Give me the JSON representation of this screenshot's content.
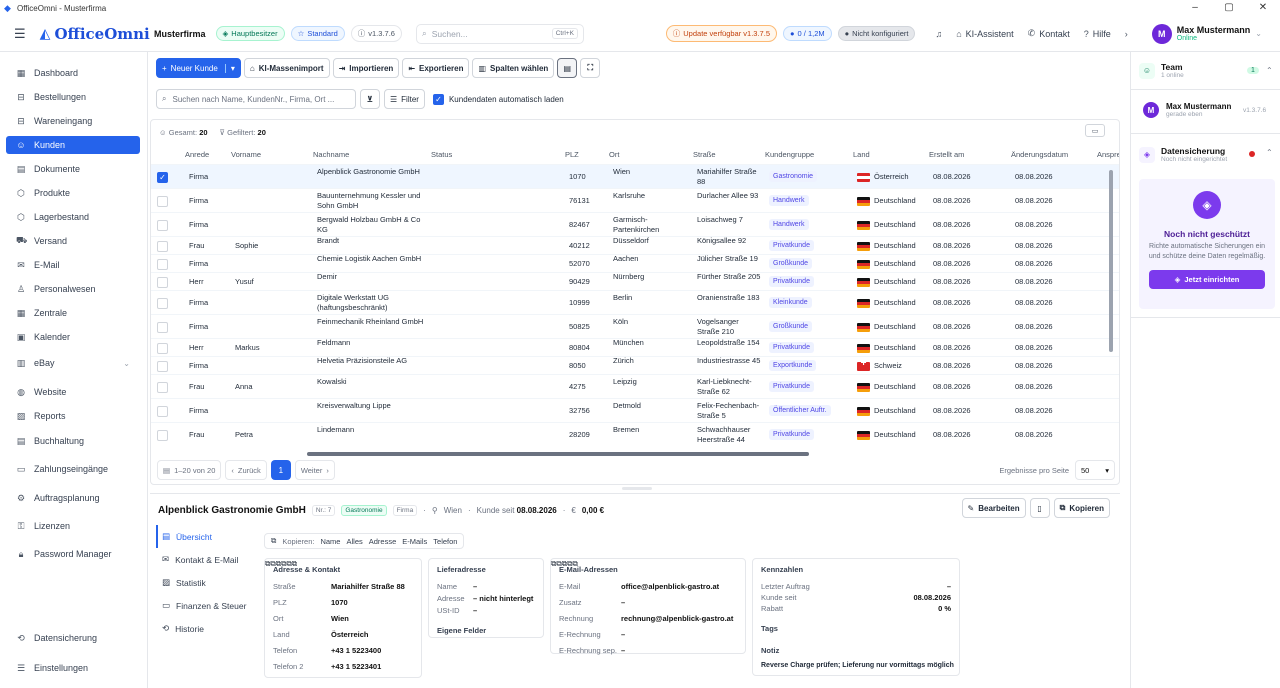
{
  "window": {
    "title": "OfficeOmni - Musterfirma",
    "minimize": "–",
    "maximize": "▢",
    "close": "✕"
  },
  "brand": {
    "name": "OfficeOmni"
  },
  "header": {
    "company": "Musterfirma",
    "badges": [
      "Hauptbesitzer",
      "Standard",
      "v1.3.7.6"
    ],
    "search_placeholder": "Suchen...",
    "search_kbd": "Ctrl+K",
    "update": "Update verfügbar v1.3.7.5",
    "storage": "0 / 1,2M",
    "sync": "Nicht konfiguriert",
    "ai_label": "KI-Assistent",
    "contact_label": "Kontakt",
    "help_label": "Hilfe",
    "user_initial": "M",
    "user_name": "Max Mustermann",
    "user_status": "Online"
  },
  "sidebar": {
    "items": [
      {
        "label": "Dashboard",
        "icon": "dashboard-icon",
        "glyph": "▦"
      },
      {
        "label": "Bestellungen",
        "icon": "cart-icon",
        "glyph": "⊟"
      },
      {
        "label": "Wareneingang",
        "icon": "cart-in-icon",
        "glyph": "⊟"
      },
      {
        "label": "Kunden",
        "icon": "users-icon",
        "glyph": "☺"
      },
      {
        "label": "Dokumente",
        "icon": "document-icon",
        "glyph": "▤"
      },
      {
        "label": "Produkte",
        "icon": "box-icon",
        "glyph": "⬡"
      },
      {
        "label": "Lagerbestand",
        "icon": "warehouse-icon",
        "glyph": "⬡"
      },
      {
        "label": "Versand",
        "icon": "truck-icon",
        "glyph": "⛟"
      },
      {
        "label": "E-Mail",
        "icon": "mail-icon",
        "glyph": "✉"
      },
      {
        "label": "Personalwesen",
        "icon": "people-icon",
        "glyph": "♙"
      },
      {
        "label": "Zentrale",
        "icon": "grid-icon",
        "glyph": "▦"
      },
      {
        "label": "Kalender",
        "icon": "calendar-icon",
        "glyph": "▣"
      },
      {
        "label": "eBay",
        "icon": "store-icon",
        "glyph": "▥"
      },
      {
        "label": "Website",
        "icon": "globe-icon",
        "glyph": "◍"
      },
      {
        "label": "Reports",
        "icon": "chart-icon",
        "glyph": "▨"
      },
      {
        "label": "Buchhaltung",
        "icon": "ledger-icon",
        "glyph": "▤"
      },
      {
        "label": "Zahlungseingänge",
        "icon": "payment-icon",
        "glyph": "▭"
      },
      {
        "label": "Auftragsplanung",
        "icon": "planning-icon",
        "glyph": "⚙"
      },
      {
        "label": "Lizenzen",
        "icon": "key-icon",
        "glyph": "⚿"
      },
      {
        "label": "Password Manager",
        "icon": "lock-icon",
        "glyph": "🔒︎"
      }
    ],
    "bottom": [
      {
        "label": "Datensicherung",
        "icon": "backup-icon",
        "glyph": "⟲"
      },
      {
        "label": "Einstellungen",
        "icon": "settings-icon",
        "glyph": "☰"
      }
    ]
  },
  "toolbar": {
    "new_customer": "Neuer Kunde",
    "ai_import": "KI-Massenimport",
    "import": "Importieren",
    "export": "Exportieren",
    "columns": "Spalten wählen"
  },
  "filter": {
    "search_placeholder": "Suchen nach Name, KundenNr., Firma, Ort ...",
    "filter_label": "Filter",
    "autoload_label": "Kundendaten automatisch laden"
  },
  "summary": {
    "total_label": "Gesamt:",
    "total": "20",
    "filtered_label": "Gefiltert:",
    "filtered": "20"
  },
  "columns": [
    "Anrede",
    "Vorname",
    "Nachname",
    "Status",
    "PLZ",
    "Ort",
    "Straße",
    "Kundengruppe",
    "Land",
    "Erstellt am",
    "Änderungsdatum",
    "Anspre"
  ],
  "rows": [
    {
      "anrede": "Firma",
      "vorname": "",
      "nachname": "Alpenblick Gastronomie GmbH",
      "plz": "1070",
      "ort": "Wien",
      "strasse": "Mariahilfer Straße 88",
      "gruppe": "Gastronomie",
      "land": "Österreich",
      "flag": "at",
      "erstellt": "08.08.2026",
      "geaendert": "08.08.2026",
      "selected": true
    },
    {
      "anrede": "Firma",
      "vorname": "",
      "nachname": "Bauunternehmung Kessler und Sohn GmbH",
      "plz": "76131",
      "ort": "Karlsruhe",
      "strasse": "Durlacher Allee 93",
      "gruppe": "Handwerk",
      "land": "Deutschland",
      "flag": "de",
      "erstellt": "08.08.2026",
      "geaendert": "08.08.2026",
      "selected": false
    },
    {
      "anrede": "Firma",
      "vorname": "",
      "nachname": "Bergwald Holzbau GmbH & Co KG",
      "plz": "82467",
      "ort": "Garmisch-Partenkirchen",
      "strasse": "Loisachweg 7",
      "gruppe": "Handwerk",
      "land": "Deutschland",
      "flag": "de",
      "erstellt": "08.08.2026",
      "geaendert": "08.08.2026",
      "selected": false
    },
    {
      "anrede": "Frau",
      "vorname": "Sophie",
      "nachname": "Brandt",
      "plz": "40212",
      "ort": "Düsseldorf",
      "strasse": "Königsallee 92",
      "gruppe": "Privatkunde",
      "land": "Deutschland",
      "flag": "de",
      "erstellt": "08.08.2026",
      "geaendert": "08.08.2026",
      "selected": false
    },
    {
      "anrede": "Firma",
      "vorname": "",
      "nachname": "Chemie Logistik Aachen GmbH",
      "plz": "52070",
      "ort": "Aachen",
      "strasse": "Jülicher Straße 19",
      "gruppe": "Großkunde",
      "land": "Deutschland",
      "flag": "de",
      "erstellt": "08.08.2026",
      "geaendert": "08.08.2026",
      "selected": false
    },
    {
      "anrede": "Herr",
      "vorname": "Yusuf",
      "nachname": "Demir",
      "plz": "90429",
      "ort": "Nürnberg",
      "strasse": "Fürther Straße 205",
      "gruppe": "Privatkunde",
      "land": "Deutschland",
      "flag": "de",
      "erstellt": "08.08.2026",
      "geaendert": "08.08.2026",
      "selected": false
    },
    {
      "anrede": "Firma",
      "vorname": "",
      "nachname": "Digitale Werkstatt UG (haftungsbeschränkt)",
      "plz": "10999",
      "ort": "Berlin",
      "strasse": "Oranienstraße 183",
      "gruppe": "Kleinkunde",
      "land": "Deutschland",
      "flag": "de",
      "erstellt": "08.08.2026",
      "geaendert": "08.08.2026",
      "selected": false
    },
    {
      "anrede": "Firma",
      "vorname": "",
      "nachname": "Feinmechanik Rheinland GmbH",
      "plz": "50825",
      "ort": "Köln",
      "strasse": "Vogelsanger Straße 210",
      "gruppe": "Großkunde",
      "land": "Deutschland",
      "flag": "de",
      "erstellt": "08.08.2026",
      "geaendert": "08.08.2026",
      "selected": false
    },
    {
      "anrede": "Herr",
      "vorname": "Markus",
      "nachname": "Feldmann",
      "plz": "80804",
      "ort": "München",
      "strasse": "Leopoldstraße 154",
      "gruppe": "Privatkunde",
      "land": "Deutschland",
      "flag": "de",
      "erstellt": "08.08.2026",
      "geaendert": "08.08.2026",
      "selected": false
    },
    {
      "anrede": "Firma",
      "vorname": "",
      "nachname": "Helvetia Präzisionsteile AG",
      "plz": "8050",
      "ort": "Zürich",
      "strasse": "Industriestrasse 45",
      "gruppe": "Exportkunde",
      "land": "Schweiz",
      "flag": "ch",
      "erstellt": "08.08.2026",
      "geaendert": "08.08.2026",
      "selected": false
    },
    {
      "anrede": "Frau",
      "vorname": "Anna",
      "nachname": "Kowalski",
      "plz": "4275",
      "ort": "Leipzig",
      "strasse": "Karl-Liebknecht-Straße 62",
      "gruppe": "Privatkunde",
      "land": "Deutschland",
      "flag": "de",
      "erstellt": "08.08.2026",
      "geaendert": "08.08.2026",
      "selected": false
    },
    {
      "anrede": "Firma",
      "vorname": "",
      "nachname": "Kreisverwaltung Lippe",
      "plz": "32756",
      "ort": "Detmold",
      "strasse": "Felix-Fechenbach-Straße 5",
      "gruppe": "Öffentlicher Auftr.",
      "land": "Deutschland",
      "flag": "de",
      "erstellt": "08.08.2026",
      "geaendert": "08.08.2026",
      "selected": false
    },
    {
      "anrede": "Frau",
      "vorname": "Petra",
      "nachname": "Lindemann",
      "plz": "28209",
      "ort": "Bremen",
      "strasse": "Schwachhauser Heerstraße 44",
      "gruppe": "Privatkunde",
      "land": "Deutschland",
      "flag": "de",
      "erstellt": "08.08.2026",
      "geaendert": "08.08.2026",
      "selected": false
    }
  ],
  "pager": {
    "range": "1–20 von 20",
    "prev": "Zurück",
    "page": "1",
    "next": "Weiter",
    "per_page_label": "Ergebnisse pro Seite",
    "per_page": "50"
  },
  "detail": {
    "name": "Alpenblick Gastronomie GmbH",
    "nr": "Nr.: 7",
    "group": "Gastronomie",
    "type": "Firma",
    "city": "Wien",
    "since_label": "Kunde seit",
    "since": "08.08.2026",
    "revenue": "0,00 €",
    "edit": "Bearbeiten",
    "copy": "Kopieren",
    "tabs": [
      {
        "label": "Übersicht",
        "icon": "overview-icon",
        "glyph": "▤"
      },
      {
        "label": "Kontakt & E-Mail",
        "icon": "mail-icon",
        "glyph": "✉"
      },
      {
        "label": "Statistik",
        "icon": "chart-icon",
        "glyph": "▨"
      },
      {
        "label": "Finanzen & Steuer",
        "icon": "finance-icon",
        "glyph": "▭"
      },
      {
        "label": "Historie",
        "icon": "history-icon",
        "glyph": "⟲"
      }
    ],
    "copybar": {
      "label": "Kopieren:",
      "items": [
        "Name",
        "Alles",
        "Adresse",
        "E-Mails",
        "Telefon"
      ]
    },
    "address": {
      "title": "Adresse & Kontakt",
      "rows": [
        {
          "k": "Straße",
          "v": "Mariahilfer Straße 88"
        },
        {
          "k": "PLZ",
          "v": "1070"
        },
        {
          "k": "Ort",
          "v": "Wien"
        },
        {
          "k": "Land",
          "v": "Österreich"
        },
        {
          "k": "Telefon",
          "v": "+43 1 5223400"
        },
        {
          "k": "Telefon 2",
          "v": "+43 1 5223401"
        }
      ]
    },
    "delivery": {
      "title": "Lieferadresse",
      "rows": [
        {
          "k": "Name",
          "v": "–"
        },
        {
          "k": "Adresse",
          "v": "– nicht hinterlegt"
        },
        {
          "k": "USt-ID",
          "v": "–"
        }
      ],
      "custom": "Eigene Felder"
    },
    "emails": {
      "title": "E-Mail-Adressen",
      "rows": [
        {
          "k": "E-Mail",
          "v": "office@alpenblick-gastro.at"
        },
        {
          "k": "Zusatz",
          "v": "–"
        },
        {
          "k": "Rechnung",
          "v": "rechnung@alpenblick-gastro.at"
        },
        {
          "k": "E-Rechnung",
          "v": "–"
        },
        {
          "k": "E-Rechnung sep.",
          "v": "–"
        }
      ]
    },
    "kpi": {
      "title": "Kennzahlen",
      "rows": [
        {
          "k": "Letzter Auftrag",
          "v": "–"
        },
        {
          "k": "Kunde seit",
          "v": "08.08.2026"
        },
        {
          "k": "Rabatt",
          "v": "0 %"
        }
      ],
      "tags_label": "Tags",
      "note_label": "Notiz",
      "note": "Reverse Charge prüfen; Lieferung nur vormittags möglich"
    }
  },
  "rightpanel": {
    "team_title": "Team",
    "team_sub": "1 online",
    "team_count": "1",
    "member_initial": "M",
    "member_name": "Max Mustermann",
    "member_sub": "gerade eben",
    "member_version": "v1.3.7.6",
    "backup_title": "Datensicherung",
    "backup_sub": "Noch nicht eingerichtet",
    "promo_title": "Noch nicht geschützt",
    "promo_text": "Richte automatische Sicherungen ein und schütze deine Daten regelmäßig.",
    "promo_cta": "Jetzt einrichten"
  }
}
